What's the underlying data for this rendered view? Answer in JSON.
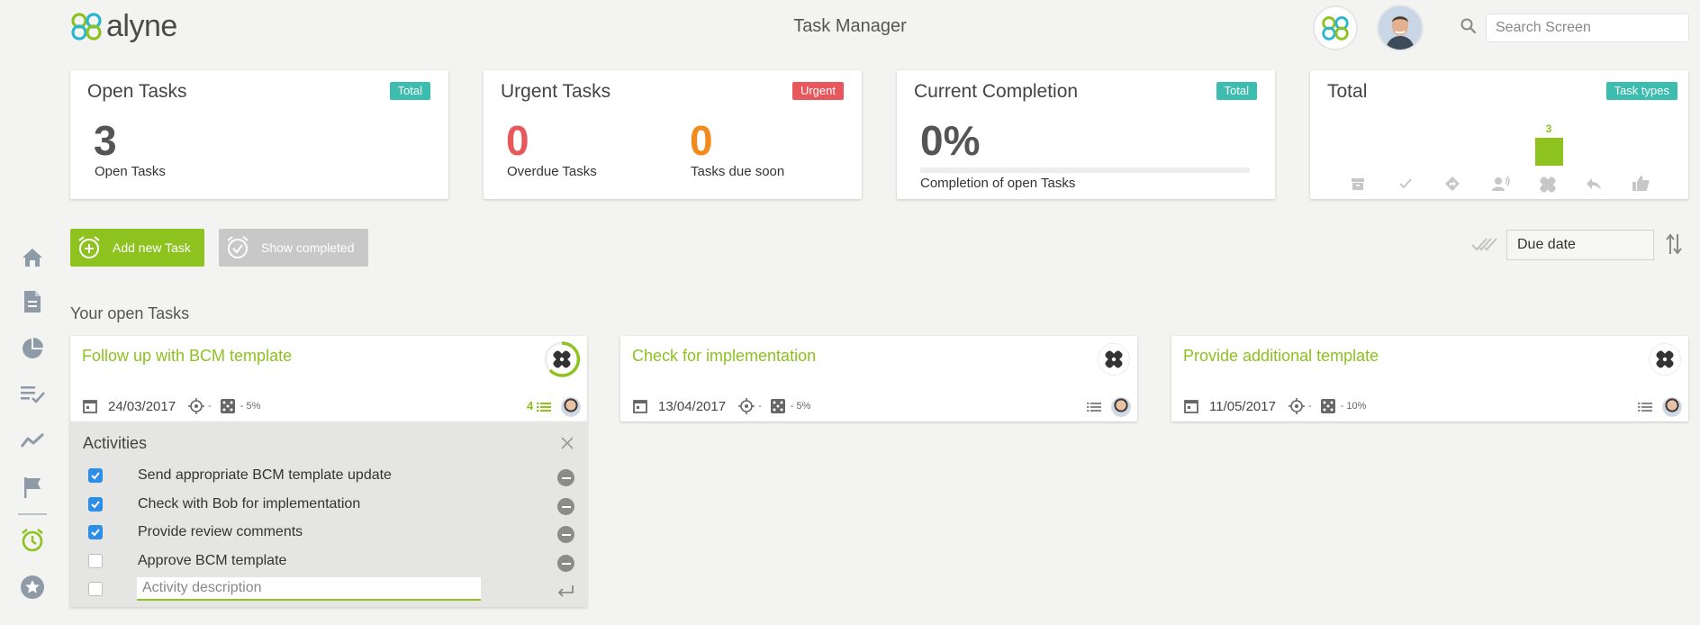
{
  "header": {
    "logo_text": "alyne",
    "title": "Task Manager",
    "search_placeholder": "Search Screen"
  },
  "sidebar": {
    "items": [
      {
        "icon": "home-icon",
        "active": false
      },
      {
        "icon": "document-icon",
        "active": false
      },
      {
        "icon": "pie-chart-icon",
        "active": false
      },
      {
        "icon": "checklist-icon",
        "active": false
      },
      {
        "icon": "trend-line-icon",
        "active": false
      },
      {
        "icon": "flag-icon",
        "active": false
      },
      {
        "icon": "alarm-clock-icon",
        "active": true
      },
      {
        "icon": "star-icon",
        "active": false
      }
    ]
  },
  "widgets": {
    "open_tasks": {
      "title": "Open Tasks",
      "badge": "Total",
      "value": "3",
      "caption": "Open Tasks"
    },
    "urgent_tasks": {
      "title": "Urgent Tasks",
      "badge": "Urgent",
      "overdue_value": "0",
      "overdue_caption": "Overdue Tasks",
      "due_soon_value": "0",
      "due_soon_caption": "Tasks due soon"
    },
    "completion": {
      "title": "Current Completion",
      "badge": "Total",
      "value": "0%",
      "progress": 0,
      "caption": "Completion of open Tasks"
    },
    "total": {
      "title": "Total",
      "badge": "Task types",
      "bar_label": "3",
      "types": [
        {
          "icon": "archive-icon",
          "count": 0
        },
        {
          "icon": "check-icon",
          "count": 0
        },
        {
          "icon": "direction-icon",
          "count": 0
        },
        {
          "icon": "people-talk-icon",
          "count": 0
        },
        {
          "icon": "bandage-icon",
          "count": 3
        },
        {
          "icon": "reply-icon",
          "count": 0
        },
        {
          "icon": "thumbs-up-icon",
          "count": 0
        }
      ]
    }
  },
  "toolbar": {
    "add_task_label": "Add new Task",
    "show_completed_label": "Show completed",
    "sort_value": "Due date"
  },
  "section_title": "Your open Tasks",
  "tasks": [
    {
      "title": "Follow up with BCM template",
      "date": "24/03/2017",
      "location": "-",
      "percent": "- 5%",
      "activities_count": "4"
    },
    {
      "title": "Check for implementation",
      "date": "13/04/2017",
      "location": "-",
      "percent": "- 5%"
    },
    {
      "title": "Provide additional template",
      "date": "11/05/2017",
      "location": "-",
      "percent": "- 10%"
    }
  ],
  "activities": {
    "title": "Activities",
    "items": [
      {
        "text": "Send appropriate BCM template update",
        "checked": true
      },
      {
        "text": "Check with Bob for implementation",
        "checked": true
      },
      {
        "text": "Provide review comments",
        "checked": true
      },
      {
        "text": "Approve BCM template",
        "checked": false
      }
    ],
    "input_placeholder": "Activity description"
  },
  "colors": {
    "accent_green": "#8dc21f",
    "teal": "#3dbcb0",
    "urgent_red": "#e8575c",
    "orange": "#f28a1c",
    "checkbox_blue": "#2d8ee6"
  }
}
